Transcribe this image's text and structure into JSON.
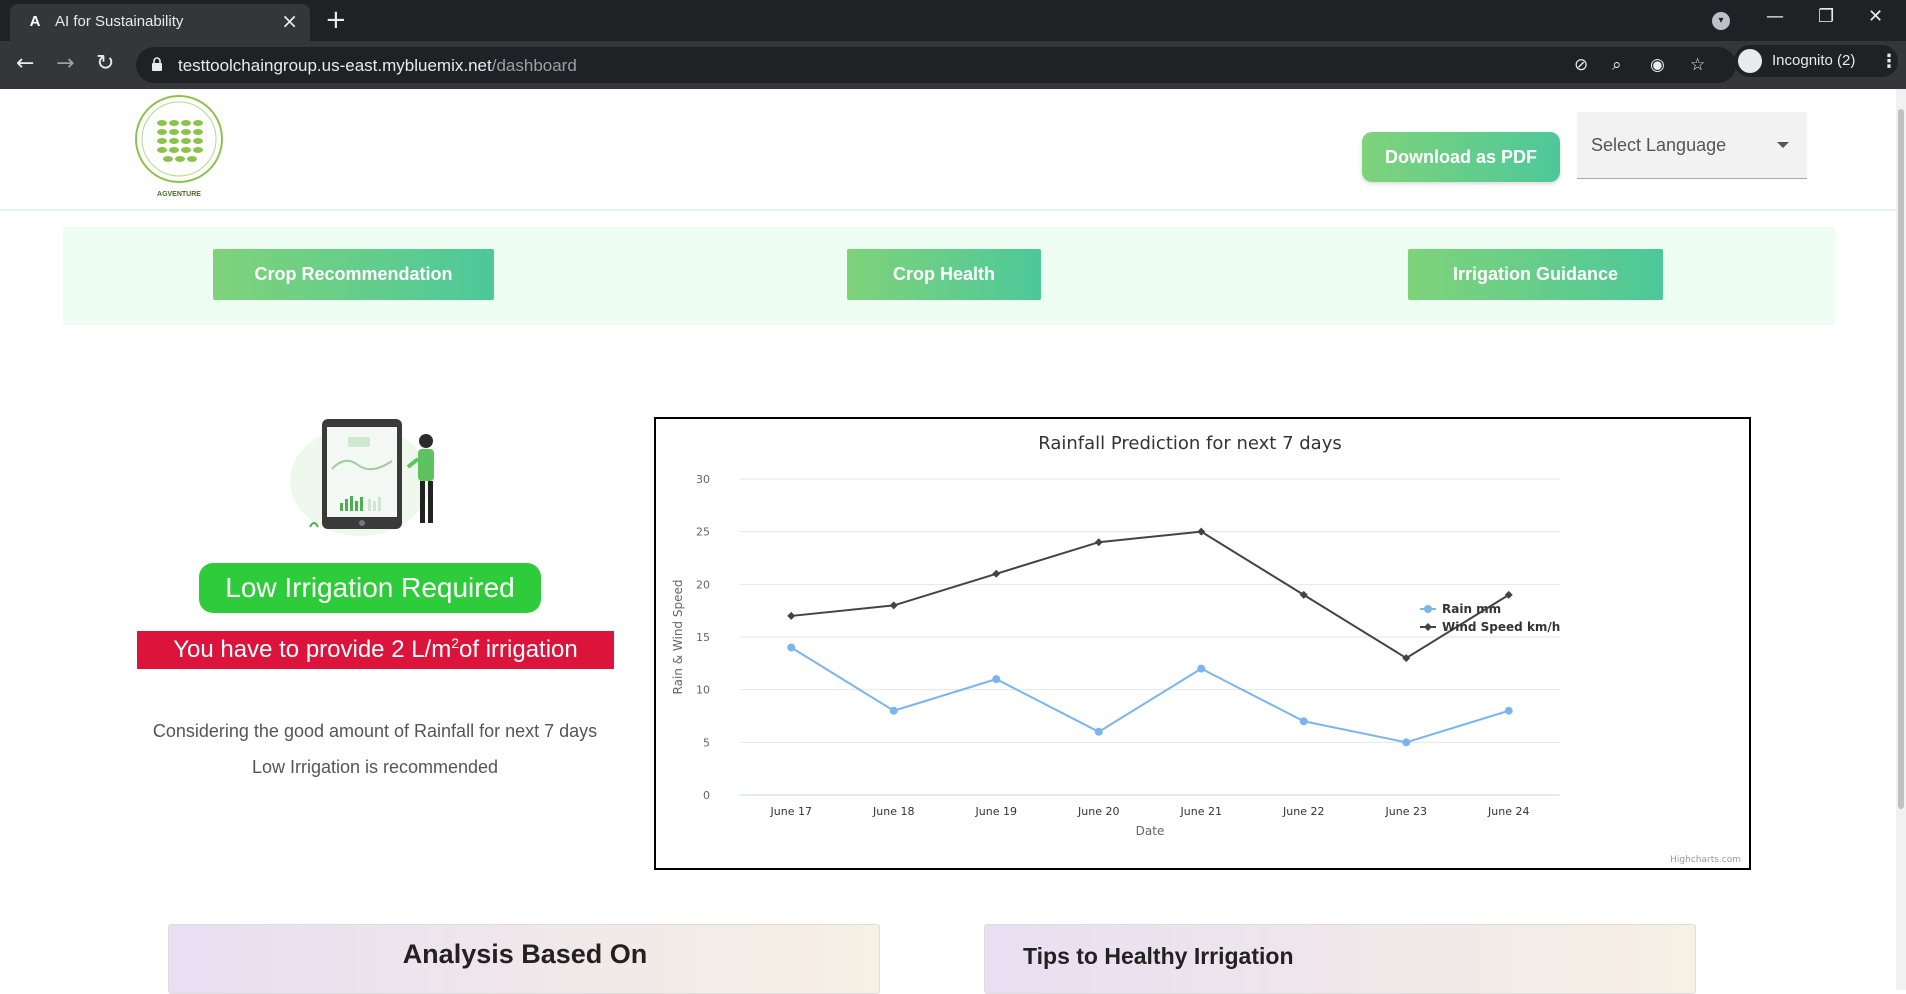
{
  "browser": {
    "tab_title": "AI for Sustainability",
    "url_host": "testtoolchaingroup.us-east.mybluemix.net",
    "url_path": "/dashboard",
    "profile_label": "Incognito (2)"
  },
  "header": {
    "logo_text": "AGVENTURE",
    "download_label": "Download as PDF",
    "language_placeholder": "Select Language"
  },
  "nav": {
    "items": [
      {
        "label": "Crop Recommendation"
      },
      {
        "label": "Crop Health"
      },
      {
        "label": "Irrigation Guidance"
      }
    ]
  },
  "result": {
    "status": "Low Irrigation Required",
    "amount_prefix": "You have to provide 2 L/m",
    "amount_sup": "2",
    "amount_suffix": "of irrigation",
    "reason_line1": "Considering the good amount of Rainfall for next 7 days",
    "reason_line2": "Low Irrigation is recommended"
  },
  "chart_data": {
    "type": "line",
    "title": "Rainfall Prediction for next 7 days",
    "xlabel": "Date",
    "ylabel": "Rain & Wind Speed",
    "categories": [
      "June 17",
      "June 18",
      "June 19",
      "June 20",
      "June 21",
      "June 22",
      "June 23",
      "June 24"
    ],
    "yticks": [
      0,
      5,
      10,
      15,
      20,
      25,
      30
    ],
    "ylim": [
      0,
      30
    ],
    "grid": true,
    "legend_position": "right",
    "credit": "Highcharts.com",
    "series": [
      {
        "name": "Rain mm",
        "color": "#7cb5ec",
        "marker": "circle",
        "values": [
          14,
          8,
          11,
          6,
          12,
          7,
          5,
          8
        ]
      },
      {
        "name": "Wind Speed km/h",
        "color": "#434348",
        "marker": "diamond",
        "values": [
          17,
          18,
          21,
          24,
          25,
          19,
          13,
          19
        ]
      }
    ]
  },
  "cards": {
    "analysis_title": "Analysis Based On",
    "tips_title": "Tips to Healthy Irrigation"
  },
  "colors": {
    "accent_green": "#4dc89a",
    "status_green": "#2ecc3b",
    "alert_red": "#dc143c"
  }
}
